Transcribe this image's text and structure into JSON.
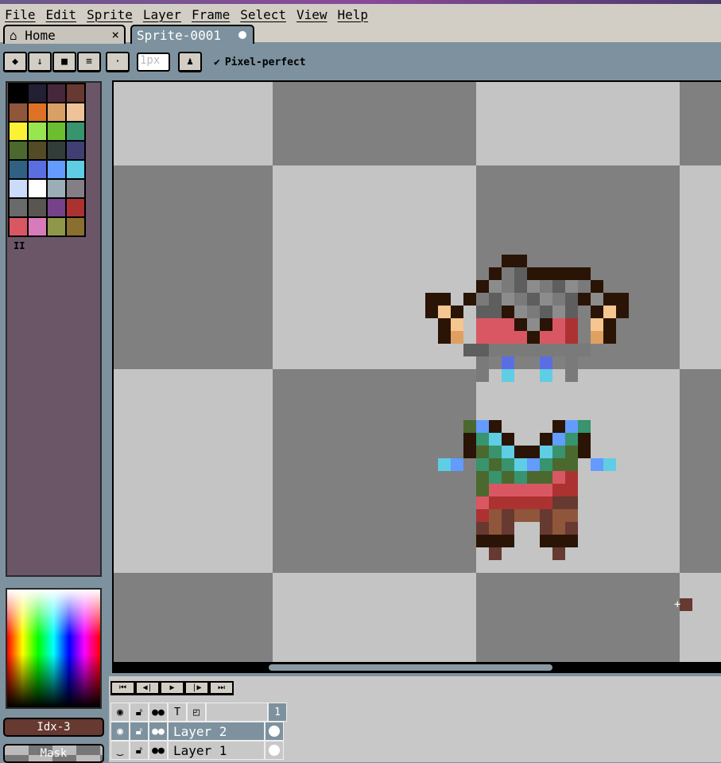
{
  "menu": [
    "File",
    "Edit",
    "Sprite",
    "Layer",
    "Frame",
    "Select",
    "View",
    "Help"
  ],
  "tabs": [
    {
      "label": "Home",
      "icon": "home-icon",
      "close": "×"
    },
    {
      "label": "Sprite-0001",
      "modified": true
    }
  ],
  "tool_options": {
    "buttons": [
      "eraser-icon",
      "arrow-down-icon",
      "square-icon",
      "lines-icon",
      "dot-icon"
    ],
    "brush_size": "1px",
    "pixel_perfect_label": "Pixel-perfect",
    "pixel_perfect_checked": true,
    "check": "✔"
  },
  "palette": {
    "colors": [
      "#000000",
      "#222034",
      "#45283c",
      "#663931",
      "#8f563b",
      "#df7126",
      "#d9a066",
      "#eec39a",
      "#fbf236",
      "#99e550",
      "#6abe30",
      "#37946e",
      "#4b692f",
      "#524b24",
      "#323c39",
      "#3f3f74",
      "#306082",
      "#5b6ee1",
      "#639bff",
      "#5fcde4",
      "#cbdbfc",
      "#ffffff",
      "#9badb7",
      "#847e87",
      "#696a6a",
      "#595652",
      "#76428a",
      "#ac3232",
      "#d95763",
      "#d77bba",
      "#8f974a",
      "#8a6f30"
    ],
    "pause_glyph": "II"
  },
  "color_bar": {
    "fg_label": "Idx-3",
    "fg_color": "#663931",
    "mask_label": "Mask"
  },
  "playback": [
    "⏮",
    "◀|",
    "▶",
    "|▶",
    "⏭"
  ],
  "timeline": {
    "header_icons": [
      "eye-icon",
      "lock-icon",
      "onion-icon",
      "pin-icon",
      "frame-icon"
    ],
    "frame_number": "1",
    "layers": [
      {
        "name": "Layer 2",
        "visible": true,
        "selected": true
      },
      {
        "name": "Layer 1",
        "visible": false,
        "selected": false
      }
    ]
  }
}
